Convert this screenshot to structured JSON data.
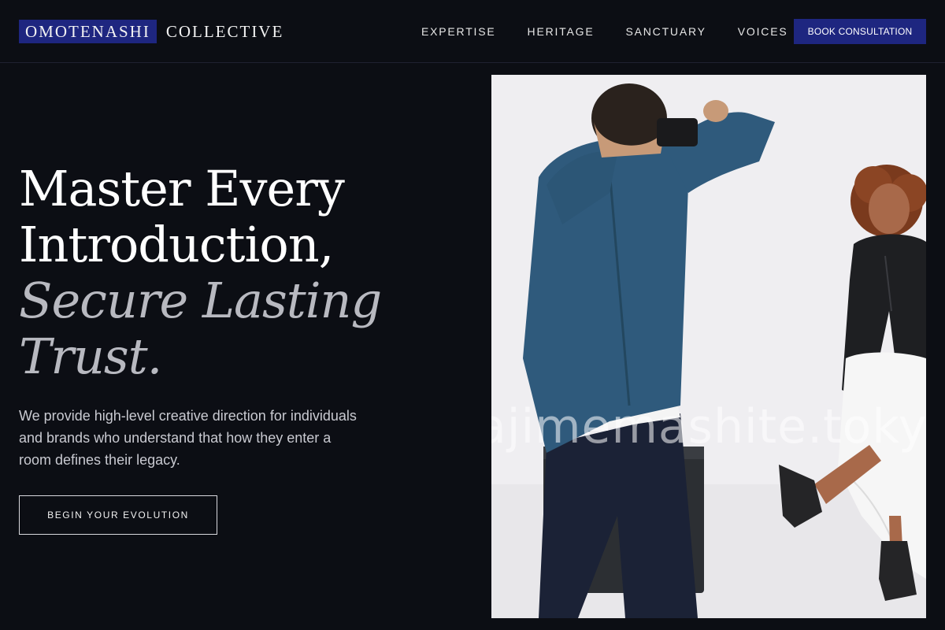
{
  "brand": {
    "mark": "OMOTENASHI",
    "word": "COLLECTIVE"
  },
  "nav": {
    "links": [
      "EXPERTISE",
      "HERITAGE",
      "SANCTUARY",
      "VOICES"
    ],
    "cta": "BOOK CONSULTATION"
  },
  "hero": {
    "title_line1": "Master Every",
    "title_line2": "Introduction,",
    "title_accent_line1": "Secure Lasting",
    "title_accent_line2": "Trust.",
    "description": "We provide high-level creative direction for individuals and brands who understand that how they enter a room defines their legacy.",
    "cta": "BEGIN YOUR EVOLUTION"
  },
  "image": {
    "watermark": "ajimemashite.tokyo"
  },
  "colors": {
    "background": "#0c0e14",
    "accent": "#1e2680",
    "muted_title": "#b8b9c0"
  }
}
